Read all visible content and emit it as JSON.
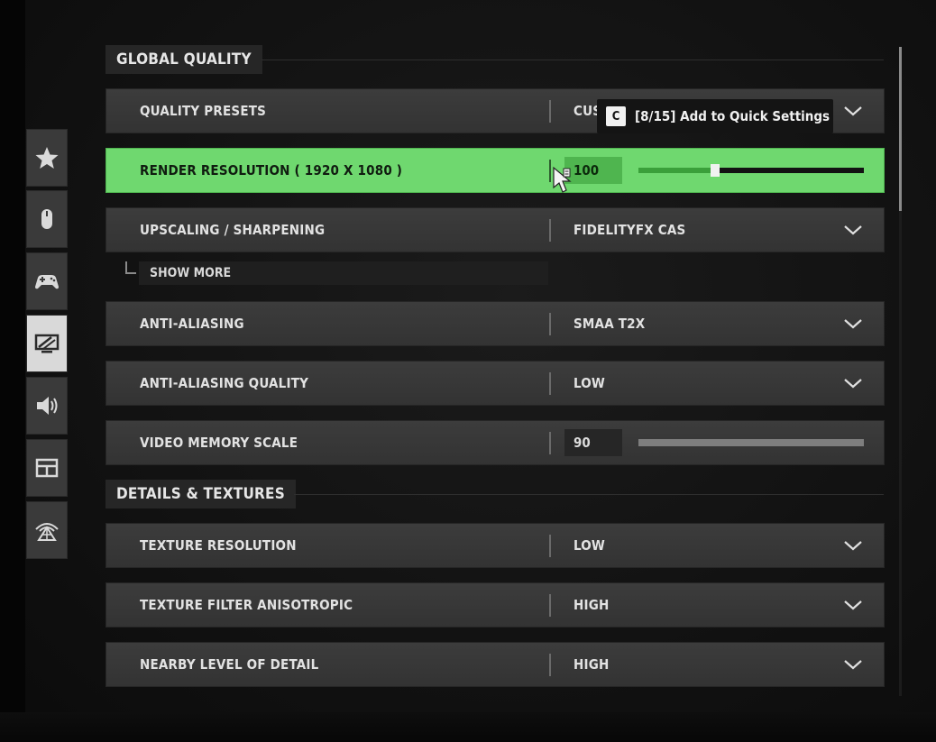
{
  "sidebar": {
    "tabs": [
      {
        "name": "favorites",
        "icon": "star-icon",
        "active": false
      },
      {
        "name": "mouse",
        "icon": "mouse-icon",
        "active": false
      },
      {
        "name": "controller",
        "icon": "gamepad-icon",
        "active": false
      },
      {
        "name": "graphics",
        "icon": "monitor-icon",
        "active": true
      },
      {
        "name": "audio",
        "icon": "speaker-icon",
        "active": false
      },
      {
        "name": "interface",
        "icon": "layout-icon",
        "active": false
      },
      {
        "name": "network",
        "icon": "network-icon",
        "active": false
      }
    ]
  },
  "sections": {
    "global_quality": "GLOBAL QUALITY",
    "details_textures": "DETAILS & TEXTURES"
  },
  "rows": {
    "quality_presets": {
      "label": "QUALITY PRESETS",
      "value": "CUS"
    },
    "render_resolution": {
      "label": "RENDER RESOLUTION ( 1920 X 1080 )",
      "value": "100",
      "slider_fraction": 0.34
    },
    "upscaling": {
      "label": "UPSCALING / SHARPENING",
      "value": "FIDELITYFX CAS"
    },
    "anti_aliasing": {
      "label": "ANTI-ALIASING",
      "value": "SMAA T2X"
    },
    "anti_aliasing_quality": {
      "label": "ANTI-ALIASING QUALITY",
      "value": "LOW"
    },
    "video_memory_scale": {
      "label": "VIDEO MEMORY SCALE",
      "value": "90",
      "slider_fraction": 1.0
    },
    "texture_resolution": {
      "label": "TEXTURE RESOLUTION",
      "value": "LOW"
    },
    "texture_filter": {
      "label": "TEXTURE FILTER ANISOTROPIC",
      "value": "HIGH"
    },
    "nearby_lod": {
      "label": "NEARBY LEVEL OF DETAIL",
      "value": "HIGH"
    }
  },
  "show_more": "SHOW MORE",
  "tooltip": {
    "key": "C",
    "text": "[8/15] Add to Quick Settings"
  },
  "colors": {
    "highlight": "#6fd86f",
    "slider_fill": "#3aa03a",
    "row_bg": "#3a3a3a"
  }
}
